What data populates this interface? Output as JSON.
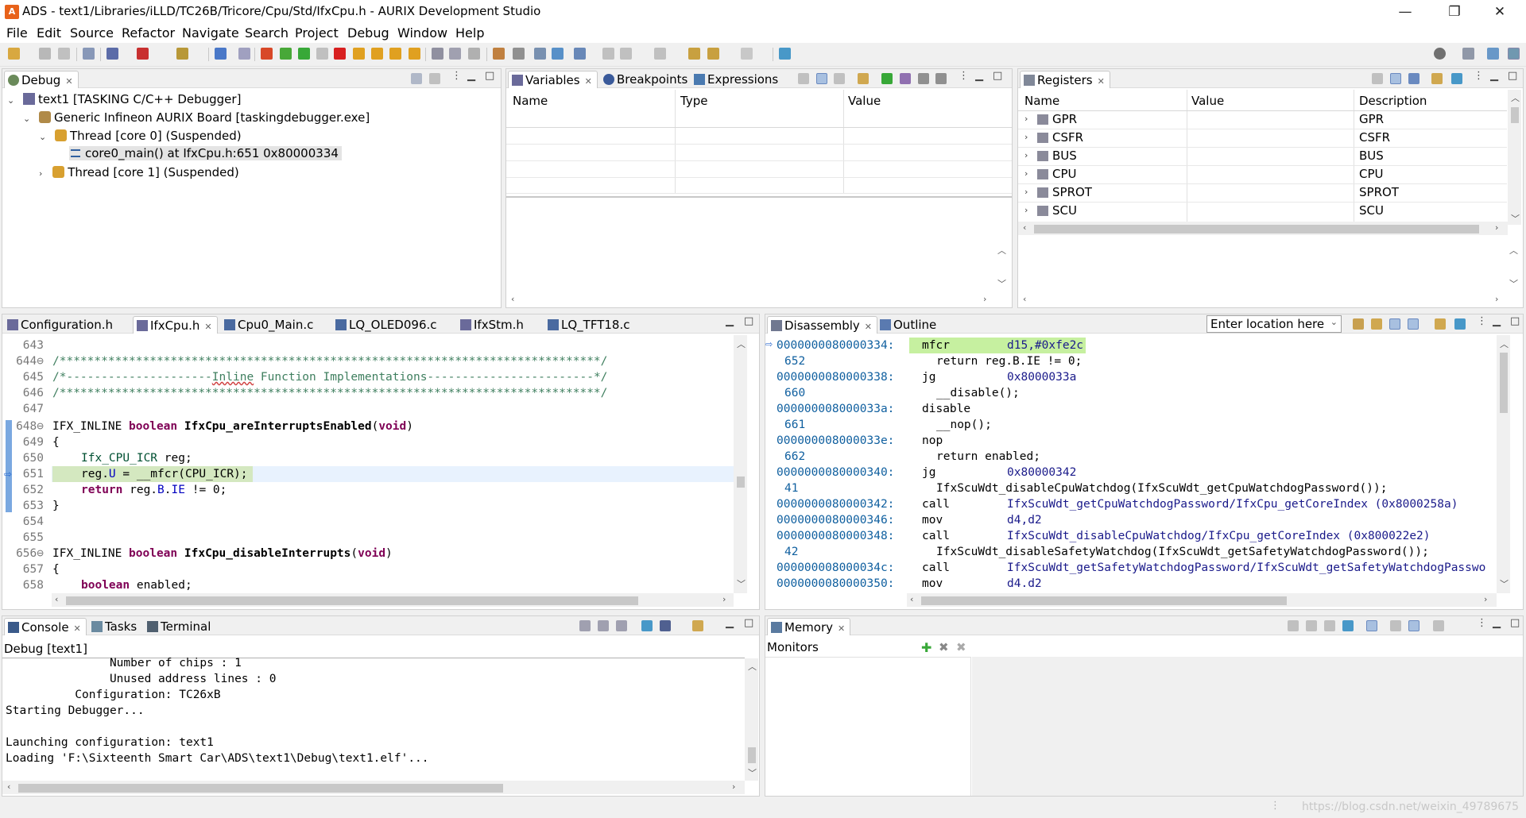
{
  "window": {
    "title": "ADS - text1/Libraries/iLLD/TC26B/Tricore/Cpu/Std/IfxCpu.h - AURIX Development Studio",
    "minimize": "—",
    "restore": "❐",
    "close": "✕"
  },
  "menubar": {
    "items": [
      "File",
      "Edit",
      "Source",
      "Refactor",
      "Navigate",
      "Search",
      "Project",
      "Debug",
      "Window",
      "Help"
    ]
  },
  "debug_view": {
    "tab": "Debug",
    "tree": [
      {
        "label": "text1 [TASKING C/C++ Debugger]",
        "icon": "debug-launch-icon"
      },
      {
        "label": "Generic Infineon AURIX Board [taskingdebugger.exe]",
        "icon": "board-icon"
      },
      {
        "label": "Thread [core 0] (Suspended)",
        "icon": "thread-icon"
      },
      {
        "label": "core0_main() at IfxCpu.h:651 0x80000334",
        "icon": "stack-frame-icon"
      },
      {
        "label": "Thread [core 1] (Suspended)",
        "icon": "thread-icon"
      }
    ]
  },
  "variables_view": {
    "tabs": [
      "Variables",
      "Breakpoints",
      "Expressions"
    ],
    "columns": [
      "Name",
      "Type",
      "Value"
    ]
  },
  "registers_view": {
    "tab": "Registers",
    "columns": [
      "Name",
      "Value",
      "Description"
    ],
    "rows": [
      {
        "name": "GPR",
        "value": "",
        "description": "GPR"
      },
      {
        "name": "CSFR",
        "value": "",
        "description": "CSFR"
      },
      {
        "name": "BUS",
        "value": "",
        "description": "BUS"
      },
      {
        "name": "CPU",
        "value": "",
        "description": "CPU"
      },
      {
        "name": "SPROT",
        "value": "",
        "description": "SPROT"
      },
      {
        "name": "SCU",
        "value": "",
        "description": "SCU"
      }
    ]
  },
  "editor": {
    "tabs": [
      "Configuration.h",
      "IfxCpu.h",
      "Cpu0_Main.c",
      "LQ_OLED096.c",
      "IfxStm.h",
      "LQ_TFT18.c"
    ],
    "active_tab": "IfxCpu.h",
    "line_numbers": [
      "643",
      "644",
      "645",
      "646",
      "647",
      "648",
      "649",
      "650",
      "651",
      "652",
      "653",
      "654",
      "655",
      "656",
      "657",
      "658"
    ],
    "lines": {
      "l644": "/******************************************************************************/",
      "l645a": "/*---------------------",
      "l645b": "Inline",
      "l645c": " Function Implementations------------------------*/",
      "l646": "/******************************************************************************/",
      "l648_macro": "IFX_INLINE ",
      "l648_type": "boolean",
      "l648_fn": "IfxCpu_areInterruptsEnabled",
      "l648_open": "(",
      "l648_void": "void",
      "l648_close": ")",
      "l649": "{",
      "l650_type": "Ifx_CPU_ICR",
      "l650_rest": " reg;",
      "l651_a": "reg.",
      "l651_b": "U",
      "l651_c": " = __mfcr(CPU_ICR);",
      "l652_kw": "return",
      "l652_a": " reg.",
      "l652_b": "B",
      "l652_c": ".",
      "l652_d": "IE",
      "l652_e": " != 0;",
      "l653": "}",
      "l656_macro": "IFX_INLINE ",
      "l656_type": "boolean",
      "l656_fn": "IfxCpu_disableInterrupts",
      "l656_open": "(",
      "l656_void": "void",
      "l656_close": ")",
      "l657": "{",
      "l658_type": "boolean",
      "l658_rest": " enabled;"
    }
  },
  "disassembly": {
    "tabs": [
      "Disassembly",
      "Outline"
    ],
    "location_placeholder": "Enter location here",
    "rows": [
      {
        "left": "0000000080000334:",
        "op": "mfcr",
        "arg": "d15,#0xfe2c",
        "kind": "addr"
      },
      {
        "left": "652",
        "src": "return reg.B.IE != 0;",
        "kind": "src"
      },
      {
        "left": "0000000080000338:",
        "op": "jg",
        "arg": "0x8000033a",
        "kind": "addr"
      },
      {
        "left": "660",
        "src": "__disable();",
        "kind": "src"
      },
      {
        "left": "000000008000033a:",
        "op": "disable",
        "arg": "",
        "kind": "addr"
      },
      {
        "left": "661",
        "src": "__nop();",
        "kind": "src"
      },
      {
        "left": "000000008000033e:",
        "op": "nop",
        "arg": "",
        "kind": "addr"
      },
      {
        "left": "662",
        "src": "return enabled;",
        "kind": "src"
      },
      {
        "left": "0000000080000340:",
        "op": "jg",
        "arg": "0x80000342",
        "kind": "addr"
      },
      {
        "left": "41",
        "src": "IfxScuWdt_disableCpuWatchdog(IfxScuWdt_getCpuWatchdogPassword());",
        "kind": "src"
      },
      {
        "left": "0000000080000342:",
        "op": "call",
        "arg": "IfxScuWdt_getCpuWatchdogPassword/IfxCpu_getCoreIndex (0x8000258a)",
        "kind": "addr"
      },
      {
        "left": "0000000080000346:",
        "op": "mov",
        "arg": "d4,d2",
        "kind": "addr"
      },
      {
        "left": "0000000080000348:",
        "op": "call",
        "arg": "IfxScuWdt_disableCpuWatchdog/IfxCpu_getCoreIndex (0x800022e2)",
        "kind": "addr"
      },
      {
        "left": "42",
        "src": "IfxScuWdt_disableSafetyWatchdog(IfxScuWdt_getSafetyWatchdogPassword());",
        "kind": "src"
      },
      {
        "left": "000000008000034c:",
        "op": "call",
        "arg": "IfxScuWdt_getSafetyWatchdogPassword/IfxScuWdt_getSafetyWatchdogPasswo",
        "kind": "addr"
      },
      {
        "left": "0000000080000350:",
        "op": "mov",
        "arg": "d4.d2",
        "kind": "addr"
      }
    ]
  },
  "console": {
    "tabs": [
      "Console",
      "Tasks",
      "Terminal"
    ],
    "header": "Debug [text1]",
    "lines": [
      "               Number of chips : 1",
      "               Unused address lines : 0",
      "          Configuration: TC26xB",
      "Starting Debugger...",
      "",
      "Launching configuration: text1",
      "Loading 'F:\\Sixteenth Smart Car\\ADS\\text1\\Debug\\text1.elf'..."
    ]
  },
  "memory": {
    "tab": "Memory",
    "monitors_label": "Monitors"
  },
  "watermark": "https://blog.csdn.net/weixin_49789675",
  "colors": {
    "current_line": "#e8f2fe",
    "disasm_highlight": "#c6f0a0",
    "keyword": "#7f0055",
    "comment": "#3f7f5f",
    "address": "#0f5f9f"
  }
}
